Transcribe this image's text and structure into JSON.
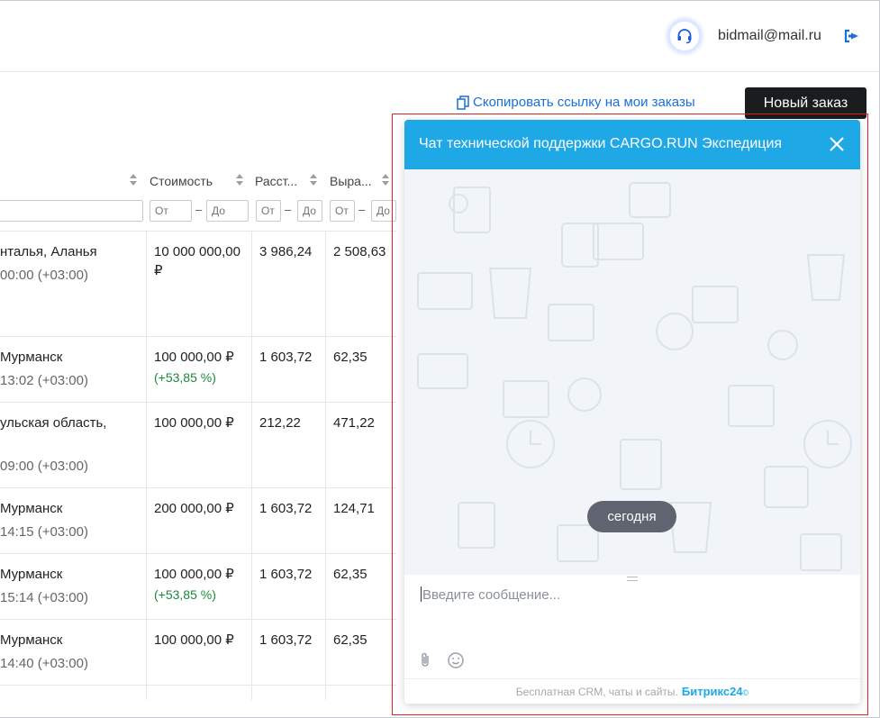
{
  "header": {
    "email": "bidmail@mail.ru"
  },
  "toolbar": {
    "copy_link": "Скопировать ссылку на мои заказы",
    "new_order": "Новый заказ"
  },
  "table": {
    "columns": [
      "Стоимость",
      "Расст...",
      "Выра..."
    ],
    "filters": {
      "from": "От",
      "to": "До"
    },
    "rows": [
      {
        "place": "нталья, Аланья",
        "time": "00:00 (+03:00)",
        "cost": "10 000 000,00",
        "cost2": "₽",
        "dist": "3 986,24",
        "rev": "2 508,63",
        "delta": ""
      },
      {
        "place": "Мурманск",
        "time": "13:02 (+03:00)",
        "cost": "100 000,00 ₽",
        "cost2": "",
        "dist": "1 603,72",
        "rev": "62,35",
        "delta": "(+53,85 %)"
      },
      {
        "place": "ульская область,",
        "time": "09:00 (+03:00)",
        "cost": "100 000,00 ₽",
        "cost2": "",
        "dist": "212,22",
        "rev": "471,22",
        "delta": ""
      },
      {
        "place": "Мурманск",
        "time": "14:15 (+03:00)",
        "cost": "200 000,00 ₽",
        "cost2": "",
        "dist": "1 603,72",
        "rev": "124,71",
        "delta": ""
      },
      {
        "place": "Мурманск",
        "time": "15:14 (+03:00)",
        "cost": "100 000,00 ₽",
        "cost2": "",
        "dist": "1 603,72",
        "rev": "62,35",
        "delta": "(+53,85 %)"
      },
      {
        "place": "Мурманск",
        "time": "14:40 (+03:00)",
        "cost": "100 000,00 ₽",
        "cost2": "",
        "dist": "1 603,72",
        "rev": "62,35",
        "delta": ""
      }
    ]
  },
  "chat": {
    "title": "Чат технической поддержки CARGO.RUN Экспедиция",
    "date_label": "сегодня",
    "input_placeholder": "Введите сообщение...",
    "footer_text": "Бесплатная CRM, чаты и сайты.",
    "footer_brand": "Битрикс24",
    "colors": {
      "header": "#1ea9e6",
      "body": "#f1f5f9",
      "date_pill": "#5f6470"
    }
  },
  "colors": {
    "accent": "#1a6fd8",
    "positive": "#1a8a3a",
    "highlight_outline": "#e02424"
  },
  "icons": [
    "headset-icon",
    "logout-icon",
    "copy-icon",
    "sort-icon",
    "close-icon",
    "paperclip-icon",
    "smile-icon"
  ]
}
